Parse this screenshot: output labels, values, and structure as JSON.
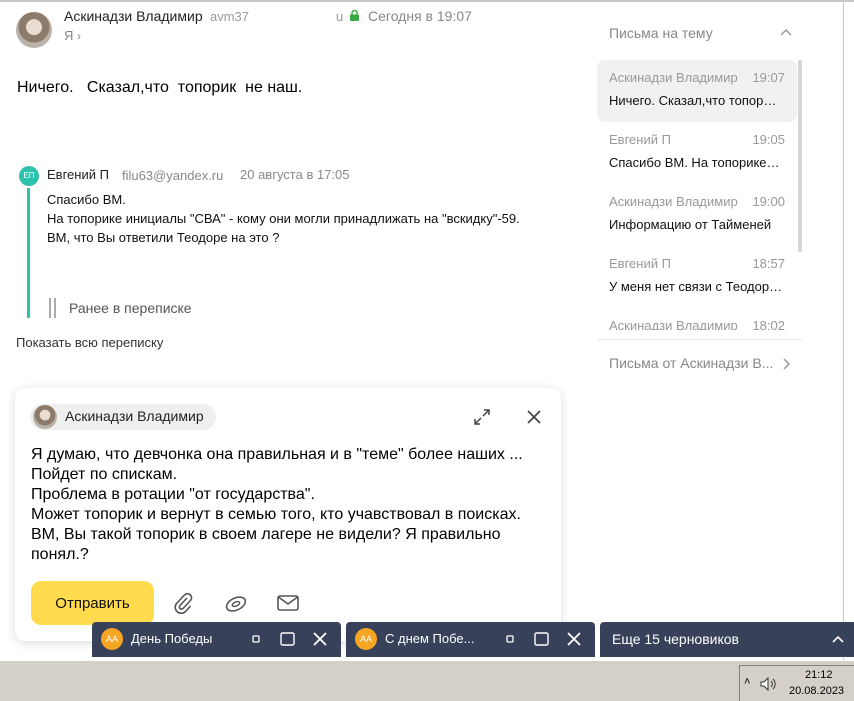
{
  "message": {
    "sender_name": "Аскинадзи Владимир",
    "sender_email": "avm37",
    "sender_email_tail": "u",
    "date": "Сегодня в 19:07",
    "to": "Я",
    "body": "Ничего.   Сказал,что  топорик  не наш."
  },
  "quoted": {
    "initials": "ЕП",
    "name": "Евгений П",
    "email": "filu63@yandex.ru",
    "date": "20 августа в 17:05",
    "lines": [
      "Спасибо ВМ.",
      "На топорике инициалы \"СВА\" - кому они могли принадлижать на \"вскидку\"-59.",
      "ВМ, что Вы ответили Теодоре на это ?"
    ],
    "earlier": "Ранее в переписке"
  },
  "show_all": "Показать всю переписку",
  "thread": {
    "title": "Письма на тему",
    "items": [
      {
        "name": "Аскинадзи Владимир",
        "time": "19:07",
        "snippet": "Ничего. Сказал,что топорик не наш."
      },
      {
        "name": "Евгений П",
        "time": "19:05",
        "snippet": "Спасибо ВМ. На топорике инициалы"
      },
      {
        "name": "Аскинадзи Владимир",
        "time": "19:00",
        "snippet": "Информацию от Тайменей"
      },
      {
        "name": "Евгений П",
        "time": "18:57",
        "snippet": "У меня нет связи с Теодорой"
      },
      {
        "name": "Аскинадзи Владимир",
        "time": "18:02",
        "snippet": ""
      }
    ],
    "letters_from": "Письма от Аскинадзи В..."
  },
  "compose": {
    "recipient": "Аскинадзи Владимир",
    "lines": [
      "Я думаю, что девчонка она правильная и в \"теме\" более наших ...",
      "Пойдет по спискам.",
      "Проблема в ротации \"от  государства\".",
      "Может топорик и вернут в семью того, кто учавствовал в поисках.",
      "ВМ, Вы такой топорик в своем лагере не видели? Я правильно понял.?"
    ],
    "send_label": "Отправить"
  },
  "drafts": [
    {
      "initials": "АА",
      "title": "День Победы"
    },
    {
      "initials": "АА",
      "title": "С днем Побе..."
    }
  ],
  "more_drafts": "Еще 15 черновиков",
  "taskbar": {
    "time": "21:12",
    "date": "20.08.2023"
  },
  "colors": {
    "accent_teal": "#2ec1ad",
    "send_yellow": "#ffdb4d",
    "draft_bg": "#38415a",
    "draft_badge": "#f6a623"
  }
}
